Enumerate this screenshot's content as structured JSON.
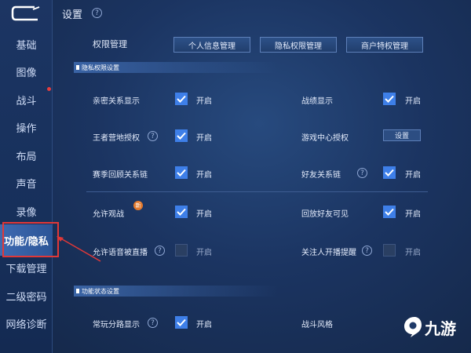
{
  "header": {
    "title": "设置"
  },
  "sidebar": {
    "items": [
      {
        "label": "基础"
      },
      {
        "label": "图像"
      },
      {
        "label": "战斗"
      },
      {
        "label": "操作"
      },
      {
        "label": "布局"
      },
      {
        "label": "声音"
      },
      {
        "label": "录像"
      },
      {
        "label": "功能/隐私",
        "active": true
      },
      {
        "label": "下载管理"
      },
      {
        "label": "二级密码"
      },
      {
        "label": "网络诊断"
      }
    ]
  },
  "permissions": {
    "label": "权限管理",
    "buttons": [
      "个人信息管理",
      "隐私权限管理",
      "商户特权管理"
    ]
  },
  "privacy_section": {
    "title": "隐私权限设置",
    "rows": [
      {
        "label": "亲密关系显示",
        "checked": true,
        "state_text": "开启"
      },
      {
        "label": "战绩显示",
        "checked": true,
        "state_text": "开启"
      },
      {
        "label": "王者营地授权",
        "checked": true,
        "state_text": "开启"
      },
      {
        "label": "游戏中心授权",
        "button_label": "设置"
      },
      {
        "label": "赛季回顾关系链",
        "checked": true,
        "state_text": "开启"
      },
      {
        "label": "好友关系链",
        "checked": true,
        "state_text": "开启"
      },
      {
        "label": "允许观战",
        "checked": true,
        "state_text": "开启",
        "badge": "新"
      },
      {
        "label": "回放好友可见",
        "checked": true,
        "state_text": "开启"
      },
      {
        "label": "允许语音被直播",
        "checked": false,
        "state_text": "开启"
      },
      {
        "label": "关注人开播提醒",
        "checked": false,
        "state_text": "开启"
      }
    ]
  },
  "function_section": {
    "title": "功能状态设置",
    "rows": [
      {
        "label": "常玩分路显示",
        "checked": true,
        "state_text": "开启"
      },
      {
        "label": "战斗风格"
      }
    ]
  },
  "watermark": {
    "text": "九游"
  },
  "colors": {
    "accent": "#3e7fe8",
    "highlight": "#e03838",
    "background": "#1b3461"
  }
}
